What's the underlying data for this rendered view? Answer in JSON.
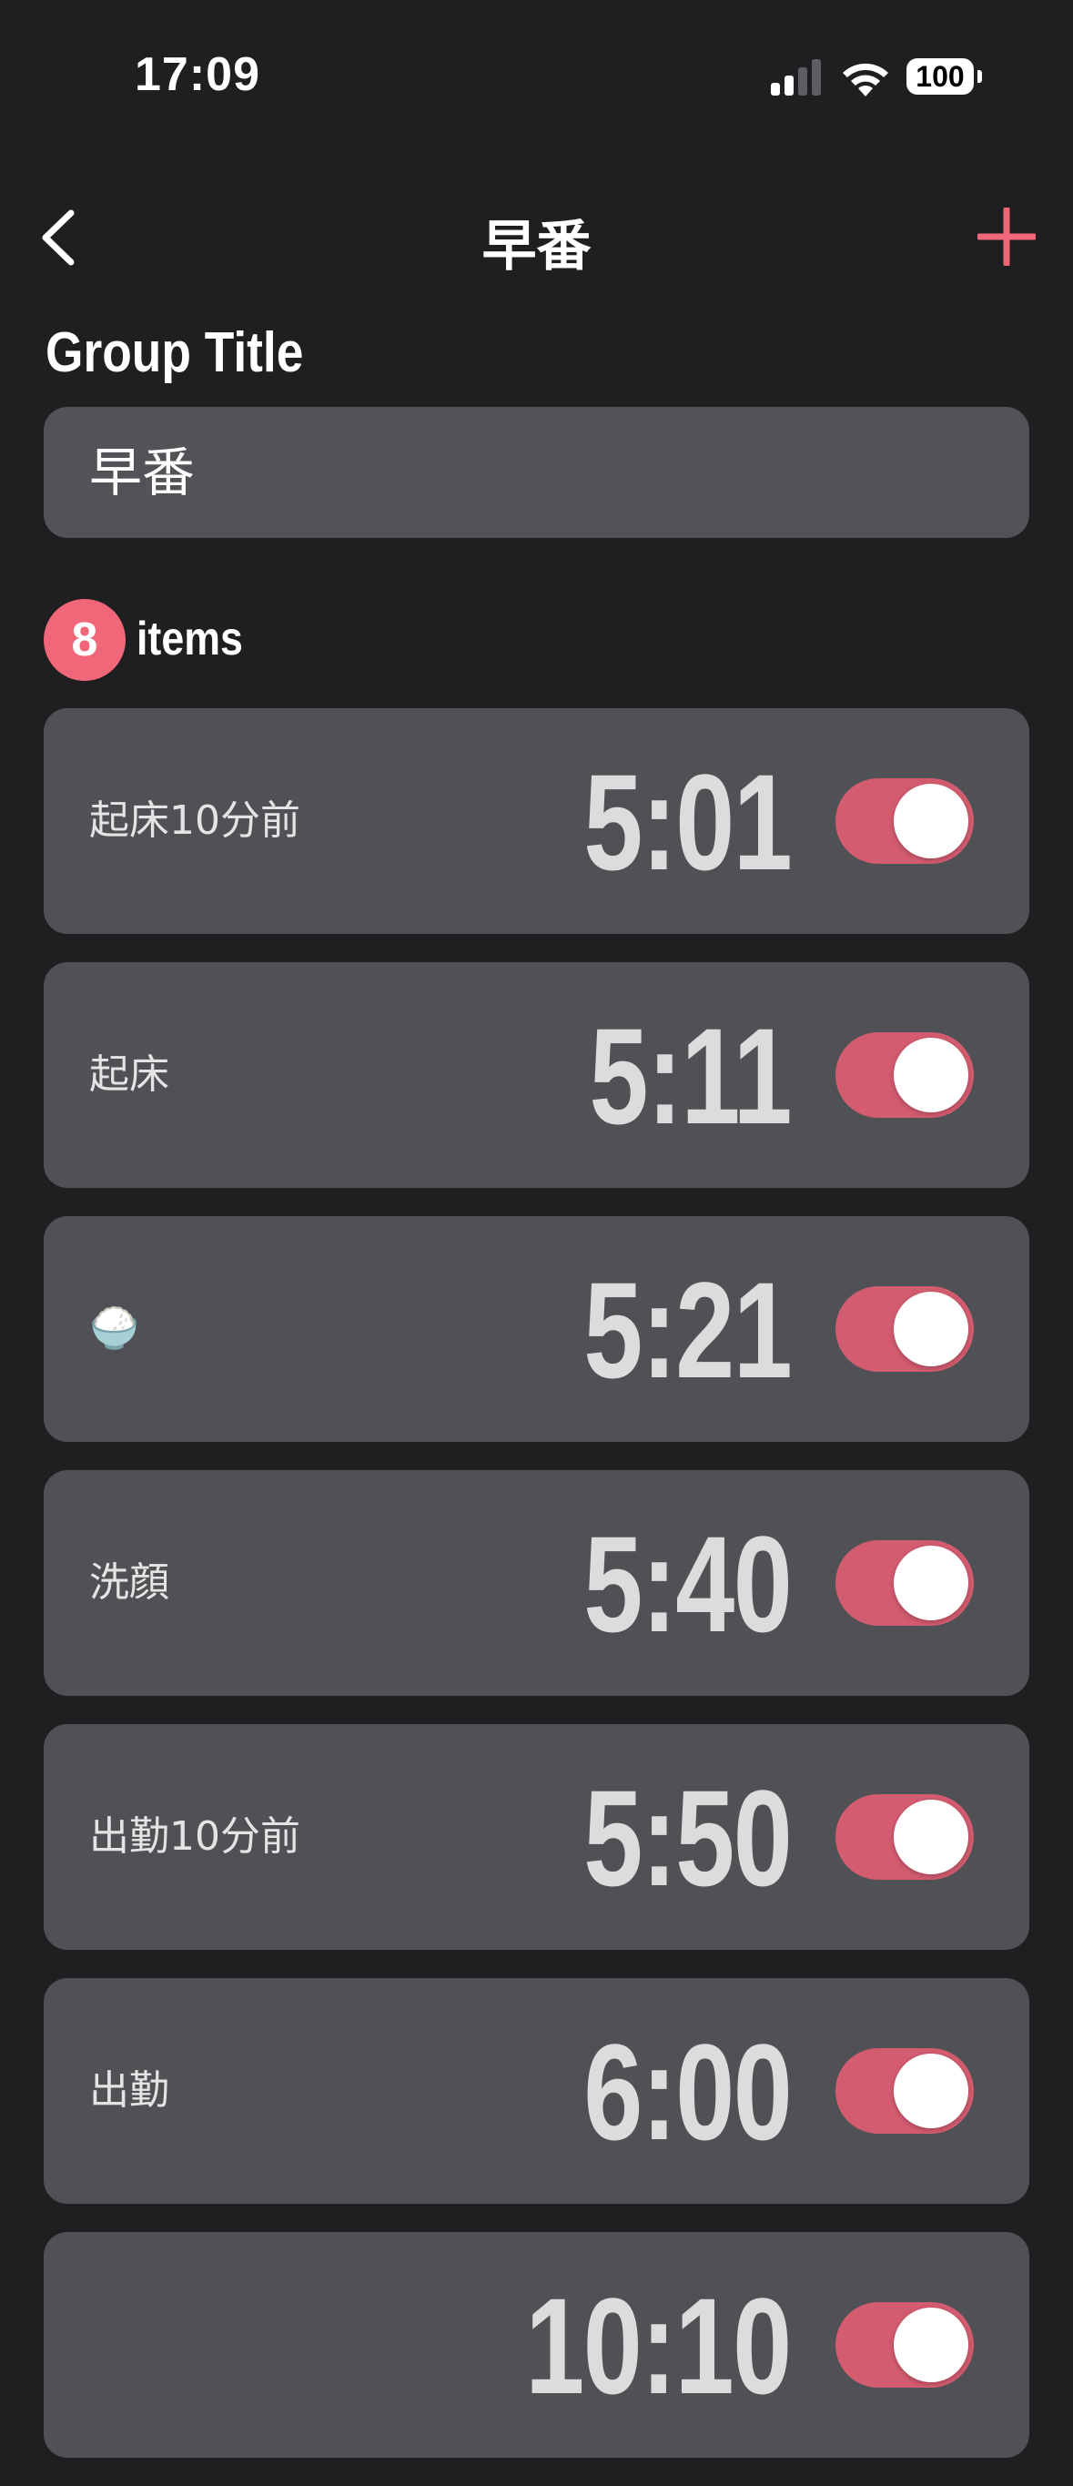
{
  "status_bar": {
    "time": "17:09",
    "battery": "100"
  },
  "nav": {
    "title": "早番"
  },
  "group": {
    "section_label": "Group Title",
    "title_value": "早番"
  },
  "items_summary": {
    "count": "8",
    "label": "items"
  },
  "alarms": [
    {
      "label": "起床10分前",
      "time": "5:01",
      "enabled": true
    },
    {
      "label": "起床",
      "time": "5:11",
      "enabled": true
    },
    {
      "label": "🍚",
      "time": "5:21",
      "enabled": true
    },
    {
      "label": "洗顔",
      "time": "5:40",
      "enabled": true
    },
    {
      "label": "出勤10分前",
      "time": "5:50",
      "enabled": true
    },
    {
      "label": "出勤",
      "time": "6:00",
      "enabled": true
    },
    {
      "label": "",
      "time": "10:10",
      "enabled": true
    }
  ],
  "colors": {
    "background": "#1f1f21",
    "card": "#505155",
    "accent": "#f0677a",
    "toggle_on": "#d45c70"
  }
}
